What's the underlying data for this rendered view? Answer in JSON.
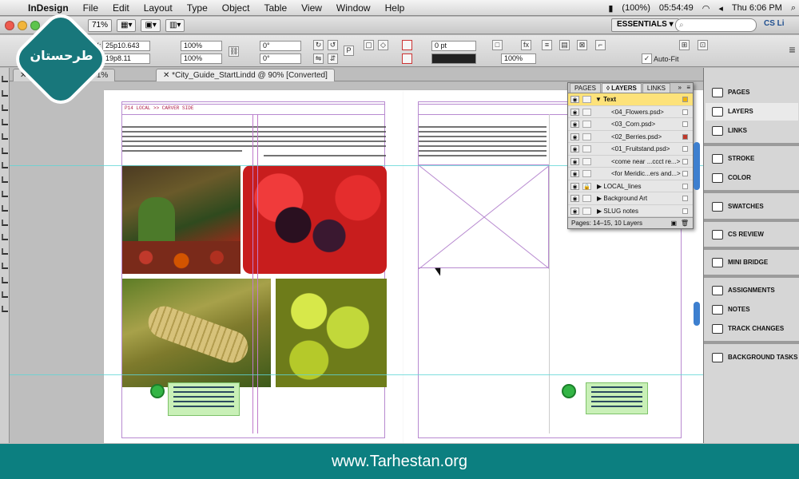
{
  "menubar": {
    "app_name": "InDesign",
    "items": [
      "File",
      "Edit",
      "Layout",
      "Type",
      "Object",
      "Table",
      "View",
      "Window",
      "Help"
    ],
    "battery": "(100%)",
    "clock_small": "05:54:49",
    "datetime": "Thu 6:06 PM"
  },
  "appbar": {
    "zoom": "71%",
    "workspace": "ESSENTIALS ▾",
    "search_placeholder": "",
    "cs_live": "CS Li"
  },
  "control": {
    "x_label": "X:",
    "y_label": "Y:",
    "x_value": "25p10.643",
    "y_value": "19p8.11",
    "scale_x": "100%",
    "scale_y": "100%",
    "rotate": "0°",
    "shear": "0°",
    "stroke_weight": "0 pt",
    "fit_value": "100%",
    "auto_fit": "Auto-Fit"
  },
  "doc_tabs": [
    {
      "label": "*Loc...ing.indd @ 71%"
    },
    {
      "label": "*City_Guide_StartLindd @ 90% [Converted]"
    }
  ],
  "page": {
    "slug": "P14   LOCAL >> CARVER SIDE"
  },
  "layers_panel": {
    "tabs": [
      "PAGES",
      "◊ LAYERS",
      "LINKS"
    ],
    "rows": [
      {
        "name": "▼ Text"
      },
      {
        "name": "<04_Flowers.psd>"
      },
      {
        "name": "<03_Corn.psd>"
      },
      {
        "name": "<02_Berries.psd>"
      },
      {
        "name": "<01_Fruitstand.psd>"
      },
      {
        "name": "<come near ...ccct re...>"
      },
      {
        "name": "<for Meridic...ers and...>"
      },
      {
        "name": "▶ LOCAL_lines"
      },
      {
        "name": "▶ Background Art"
      },
      {
        "name": "▶ SLUG notes"
      }
    ],
    "footer": "Pages: 14–15, 10 Layers"
  },
  "right_panel": {
    "items": [
      "PAGES",
      "LAYERS",
      "LINKS",
      "STROKE",
      "COLOR",
      "SWATCHES",
      "CS REVIEW",
      "MINI BRIDGE",
      "ASSIGNMENTS",
      "NOTES",
      "TRACK CHANGES",
      "BACKGROUND TASKS"
    ]
  },
  "watermark": {
    "url": "www.Tarhestan.org",
    "logo_text": "طرحستان"
  },
  "colors": {
    "guide": "#5fd6d6",
    "selection": "#fde27a",
    "brand_teal": "#0c7f80"
  }
}
